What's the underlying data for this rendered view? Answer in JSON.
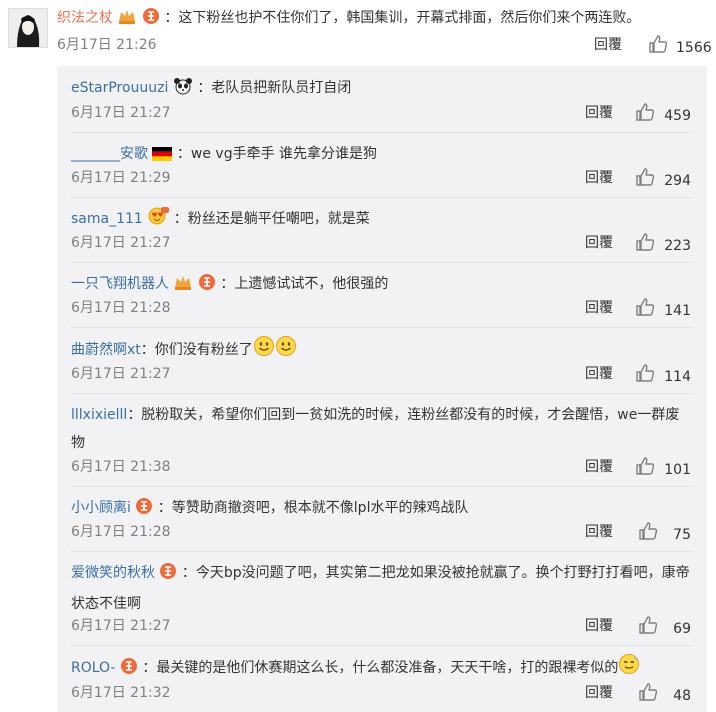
{
  "top_comment": {
    "username": "织法之杖",
    "text": "：这下粉丝也护不住你们了，韩国集训，开幕式排面，然后你们来个两连败。",
    "time": "6月17日 21:26",
    "reply": "回覆",
    "likes": "1566"
  },
  "replies": [
    {
      "username": "eStarProuuuzi",
      "text": "：老队员把新队员打自闭",
      "time": "6月17日 21:27",
      "reply": "回覆",
      "likes": "459"
    },
    {
      "username": "_______安歌",
      "text": "：we vg手牵手 谁先拿分谁是狗",
      "time": "6月17日 21:29",
      "reply": "回覆",
      "likes": "294"
    },
    {
      "username": "sama_111",
      "text": "：粉丝还是躺平任嘲吧，就是菜",
      "time": "6月17日 21:27",
      "reply": "回覆",
      "likes": "223"
    },
    {
      "username": "一只飞翔机器人",
      "text": "：上遗憾试试不，他很强的",
      "time": "6月17日 21:28",
      "reply": "回覆",
      "likes": "141"
    },
    {
      "username": "曲蔚然啊xt",
      "text": "：你们没有粉丝了",
      "time": "6月17日 21:27",
      "reply": "回覆",
      "likes": "114"
    },
    {
      "username": "lllxixielll",
      "text": "：脱粉取关，希望你们回到一贫如洗的时候，连粉丝都没有的时候，才会醒悟，we一群废物",
      "time": "6月17日 21:38",
      "reply": "回覆",
      "likes": "101"
    },
    {
      "username": "小小顾离i",
      "text": "：等赞助商撤资吧，根本就不像lpl水平的辣鸡战队",
      "time": "6月17日 21:28",
      "reply": "回覆",
      "likes": "75"
    },
    {
      "username": "爱微笑的秋秋",
      "text": "：今天bp没问题了吧，其实第二把龙如果没被抢就赢了。换个打野打打看吧，康帝状态不佳啊",
      "time": "6月17日 21:27",
      "reply": "回覆",
      "likes": "69"
    },
    {
      "username": "ROLO-",
      "text": "：最关键的是他们休赛期这么长，什么都没准备，天天干啥，打的跟裸考似的",
      "time": "6月17日 21:32",
      "reply": "回覆",
      "likes": "48"
    }
  ]
}
